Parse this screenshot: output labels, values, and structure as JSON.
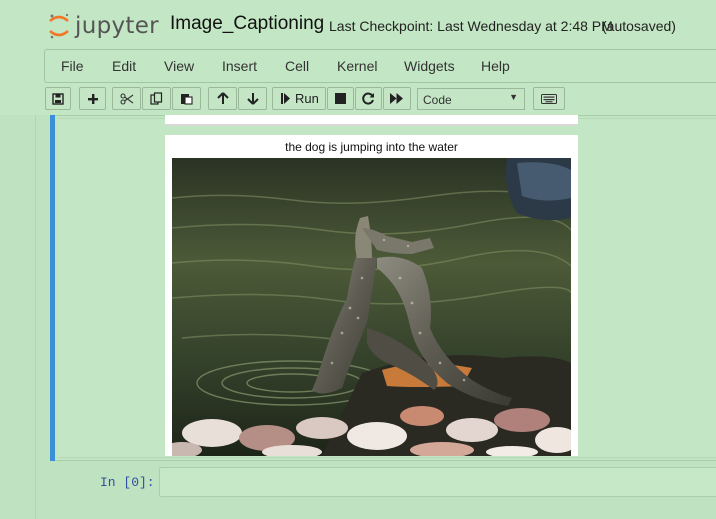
{
  "app": {
    "logo_text": "jupyter",
    "notebook_title": "Image_Captioning",
    "checkpoint": "Last Checkpoint: Last Wednesday at 2:48 PM",
    "autosave_status": "(autosaved)"
  },
  "menu": {
    "items": [
      {
        "label": "File"
      },
      {
        "label": "Edit"
      },
      {
        "label": "View"
      },
      {
        "label": "Insert"
      },
      {
        "label": "Cell"
      },
      {
        "label": "Kernel"
      },
      {
        "label": "Widgets"
      },
      {
        "label": "Help"
      }
    ]
  },
  "toolbar": {
    "run_label": "Run",
    "cell_type": "Code",
    "icons": [
      "save-icon",
      "plus-icon",
      "cut-icon",
      "copy-icon",
      "paste-icon",
      "arrow-up-icon",
      "arrow-down-icon",
      "step-forward-icon",
      "stop-icon",
      "restart-icon",
      "fast-forward-icon",
      "keyboard-icon"
    ]
  },
  "output": {
    "caption": "the dog is jumping into the water",
    "image_subject": "two monitor lizards wrestling in shallow water"
  },
  "next_cell": {
    "prompt": "In [0]:",
    "value": ""
  }
}
